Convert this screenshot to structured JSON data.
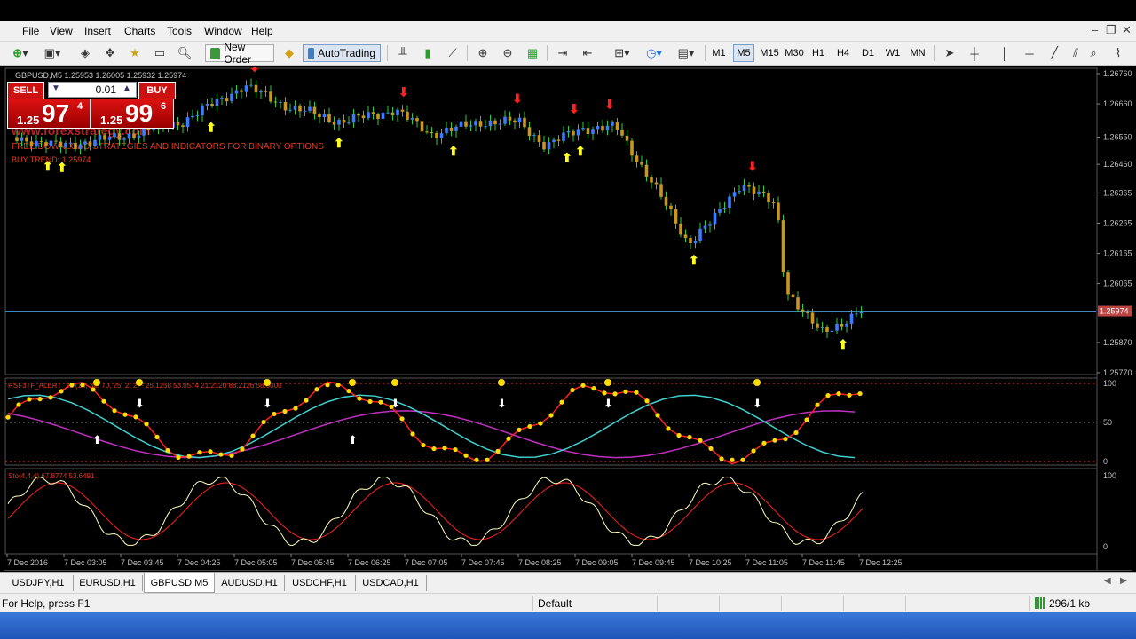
{
  "menu": {
    "items": [
      "File",
      "View",
      "Insert",
      "Charts",
      "Tools",
      "Window",
      "Help"
    ],
    "window_controls": [
      "–",
      "❐",
      "✕"
    ]
  },
  "toolbar": {
    "new_order": "New Order",
    "autotrading": "AutoTrading",
    "timeframes": [
      "M1",
      "M5",
      "M15",
      "M30",
      "H1",
      "H4",
      "D1",
      "W1",
      "MN"
    ],
    "selected_timeframe": "M5"
  },
  "chart": {
    "header": "GBPUSD,M5  1.25953 1.26005 1.25932 1.25974",
    "one_click": {
      "sell": "SELL",
      "buy": "BUY",
      "qty": "0.01",
      "sell_prefix": "1.25",
      "sell_big": "97",
      "sell_sup": "4",
      "buy_prefix": "1.25",
      "buy_big": "99",
      "buy_sup": "6"
    },
    "overlay_text_1": "www.forexstrategy.com",
    "overlay_text_2": "FREE DOWNLOAD STRATEGIES AND INDICATORS FOR BINARY OPTIONS",
    "overlay_text_3": "BUY TREND: 1.25974",
    "price_levels": [
      "1.26760",
      "1.26660",
      "1.26550",
      "1.26460",
      "1.26365",
      "1.26265",
      "1.26165",
      "1.26065",
      "1.25974",
      "1.25870",
      "1.25770"
    ],
    "current_price": "1.25974",
    "colors": {
      "bull": "#3b7bff",
      "bear": "#c8961e",
      "wick": "#2ecc40",
      "last": "#4682b4"
    }
  },
  "rsi_panel": {
    "label": "RSI-3TF_ALERT_22 (14, 30, 70, 25, 2, 2) · 25.1258 53.0574 21.2120 88.2126 58.0000",
    "levels": [
      "100",
      "50",
      "0"
    ]
  },
  "sto_panel": {
    "label": "Sto(4,4,4) 67.8774 53.6491",
    "levels": [
      "100",
      "0"
    ]
  },
  "time_axis": [
    "7 Dec 2016",
    "7 Dec 03:05",
    "7 Dec 03:45",
    "7 Dec 04:25",
    "7 Dec 05:05",
    "7 Dec 05:45",
    "7 Dec 06:25",
    "7 Dec 07:05",
    "7 Dec 07:45",
    "7 Dec 08:25",
    "7 Dec 09:05",
    "7 Dec 09:45",
    "7 Dec 10:25",
    "7 Dec 11:05",
    "7 Dec 11:45",
    "7 Dec 12:25"
  ],
  "tabs": [
    "USDJPY,H1",
    "EURUSD,H1",
    "GBPUSD,M5",
    "AUDUSD,H1",
    "USDCHF,H1",
    "USDCAD,H1"
  ],
  "active_tab": "GBPUSD,M5",
  "status": {
    "help": "For Help, press F1",
    "profile": "Default",
    "traffic": "296/1 kb"
  }
}
